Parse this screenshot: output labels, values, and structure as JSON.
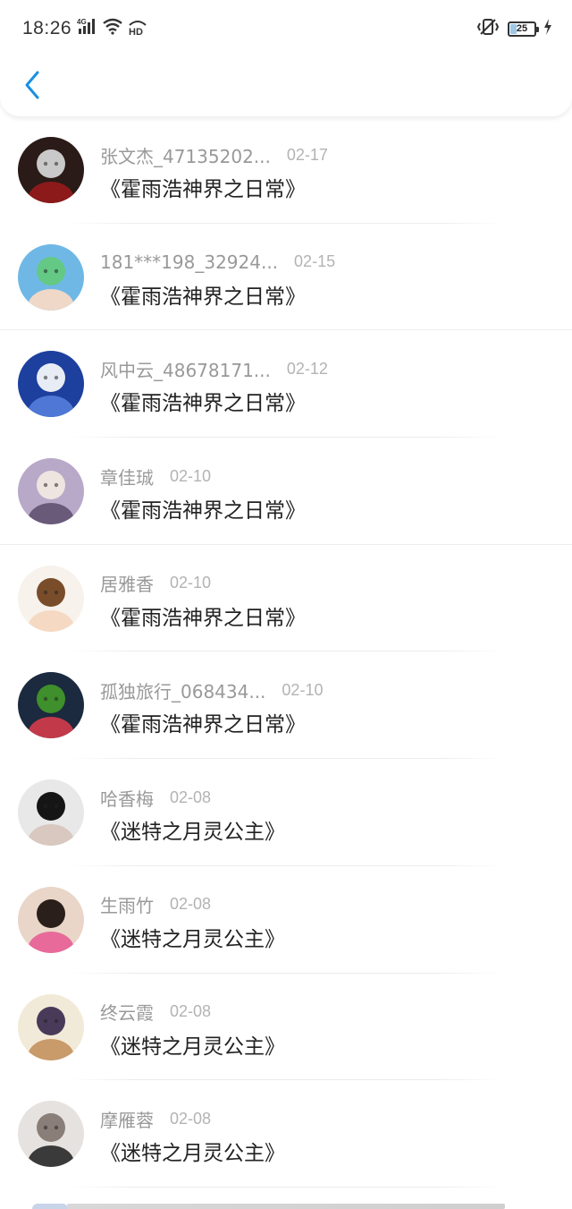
{
  "status_bar": {
    "time": "18:26",
    "network": "4G",
    "wifi_hd": "HD",
    "battery": "25"
  },
  "navbar": {
    "back_icon": "chevron-left-icon",
    "accent_color": "#1a8fe3"
  },
  "items": [
    {
      "name": "张文杰_47135202...",
      "date": "02-17",
      "book": "《霍雨浩神界之日常》",
      "avatar": {
        "bg": "#2a1a18",
        "fg": "#c9c9c9",
        "accent": "#8c1a1a"
      },
      "divider": "inset"
    },
    {
      "name": "181***198_32924...",
      "date": "02-15",
      "book": "《霍雨浩神界之日常》",
      "avatar": {
        "bg": "#6fb8e6",
        "fg": "#63c985",
        "accent": "#f0d8c8"
      },
      "divider": "full"
    },
    {
      "name": "风中云_48678171...",
      "date": "02-12",
      "book": "《霍雨浩神界之日常》",
      "avatar": {
        "bg": "#1d3f9e",
        "fg": "#e8ecf5",
        "accent": "#4f78d6"
      },
      "divider": "inset"
    },
    {
      "name": "章佳珹",
      "date": "02-10",
      "book": "《霍雨浩神界之日常》",
      "avatar": {
        "bg": "#b9a9c8",
        "fg": "#efe5e0",
        "accent": "#6a5a7a"
      },
      "divider": "full"
    },
    {
      "name": "居雅香",
      "date": "02-10",
      "book": "《霍雨浩神界之日常》",
      "avatar": {
        "bg": "#f7f2ec",
        "fg": "#7a4d2a",
        "accent": "#f6d9c2"
      },
      "divider": "inset"
    },
    {
      "name": "孤独旅行_068434...",
      "date": "02-10",
      "book": "《霍雨浩神界之日常》",
      "avatar": {
        "bg": "#1b2a3e",
        "fg": "#3f8f2c",
        "accent": "#c23a4a"
      },
      "divider": "inset"
    },
    {
      "name": "哈香梅",
      "date": "02-08",
      "book": "《迷特之月灵公主》",
      "avatar": {
        "bg": "#e8e8e8",
        "fg": "#151515",
        "accent": "#d8c8c0"
      },
      "divider": "inset"
    },
    {
      "name": "生雨竹",
      "date": "02-08",
      "book": "《迷特之月灵公主》",
      "avatar": {
        "bg": "#e9d6c8",
        "fg": "#2a1f1a",
        "accent": "#e86a9a"
      },
      "divider": "inset"
    },
    {
      "name": "终云霞",
      "date": "02-08",
      "book": "《迷特之月灵公主》",
      "avatar": {
        "bg": "#f2ead8",
        "fg": "#4a3a5a",
        "accent": "#c99a6a"
      },
      "divider": "inset"
    },
    {
      "name": "摩雁蓉",
      "date": "02-08",
      "book": "《迷特之月灵公主》",
      "avatar": {
        "bg": "#e6e2df",
        "fg": "#8a7e78",
        "accent": "#3a3a3a"
      },
      "divider": "inset"
    }
  ]
}
